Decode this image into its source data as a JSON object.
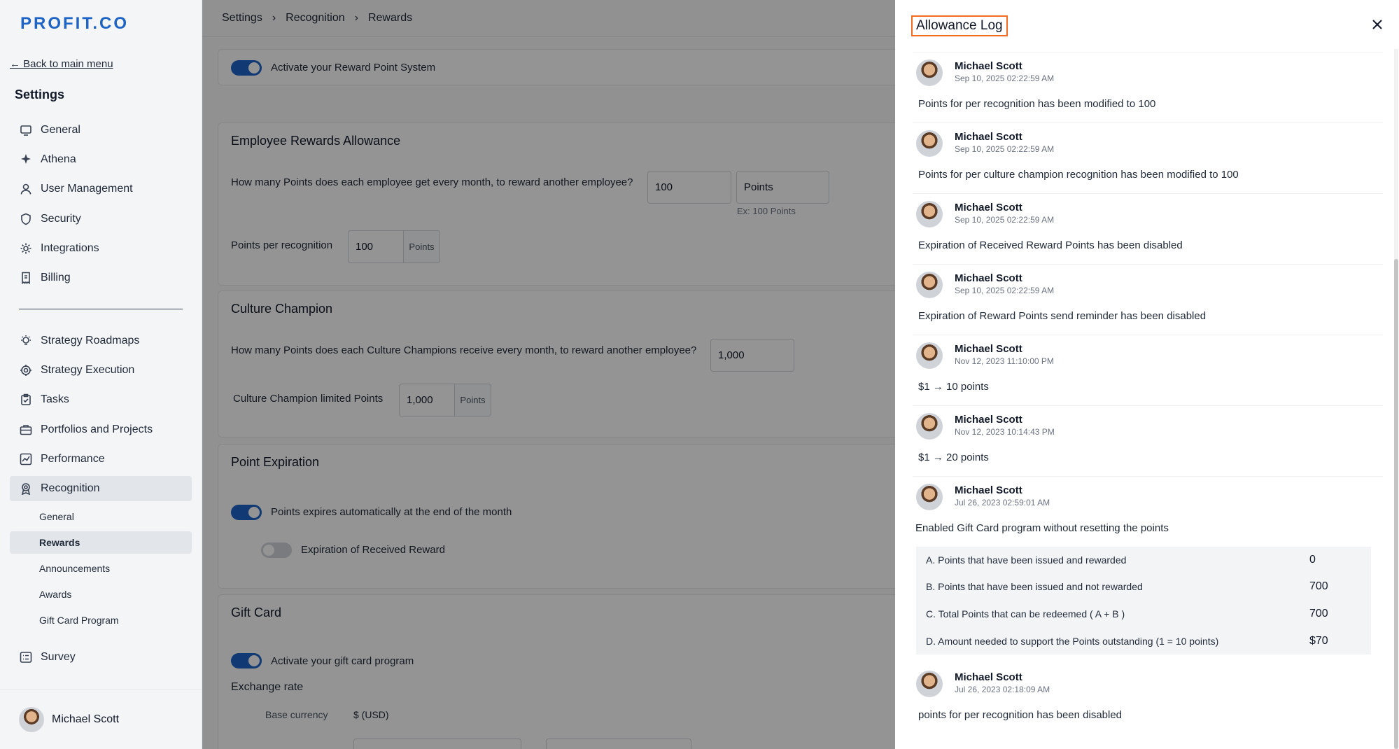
{
  "sidebar": {
    "logo": "PROFIT.CO",
    "back_link": "← Back to main menu",
    "heading": "Settings",
    "items": [
      {
        "label": "General",
        "icon": "monitor-icon"
      },
      {
        "label": "Athena",
        "icon": "sparkle-icon"
      },
      {
        "label": "User Management",
        "icon": "user-icon"
      },
      {
        "label": "Security",
        "icon": "shield-icon"
      },
      {
        "label": "Integrations",
        "icon": "gear-icon"
      },
      {
        "label": "Billing",
        "icon": "receipt-icon"
      }
    ],
    "items2": [
      {
        "label": "Strategy Roadmaps",
        "icon": "bulb-icon"
      },
      {
        "label": "Strategy Execution",
        "icon": "target-icon"
      },
      {
        "label": "Tasks",
        "icon": "clipboard-icon"
      },
      {
        "label": "Portfolios and Projects",
        "icon": "briefcase-icon"
      },
      {
        "label": "Performance",
        "icon": "chart-icon"
      },
      {
        "label": "Recognition",
        "icon": "award-icon"
      }
    ],
    "recognition_sub": [
      "General",
      "Rewards",
      "Announcements",
      "Awards",
      "Gift Card Program"
    ],
    "survey": {
      "label": "Survey",
      "icon": "survey-icon"
    },
    "user_name": "Michael Scott"
  },
  "breadcrumb": [
    "Settings",
    "›",
    "Recognition",
    "›",
    "Rewards"
  ],
  "main": {
    "activate_label": "Activate your Reward Point System",
    "allowance": {
      "title": "Employee Rewards Allowance",
      "question": "How many Points does each employee get every month, to reward another employee?",
      "value": "100",
      "unit": "Points",
      "hint": "Ex: 100 Points",
      "per_recognition_label": "Points per recognition",
      "per_recognition_value": "100",
      "per_recognition_unit": "Points"
    },
    "champion": {
      "title": "Culture Champion",
      "question": "How many Points does each Culture Champions receive every month, to reward another employee?",
      "value": "1,000",
      "limited_label": "Culture Champion limited Points",
      "limited_value": "1,000",
      "limited_unit": "Points"
    },
    "expiration": {
      "title": "Point Expiration",
      "auto_label": "Points expires automatically at the end of the month",
      "received_label": "Expiration of Received Reward"
    },
    "gift": {
      "title": "Gift Card",
      "activate_label": "Activate your gift card program",
      "exchange_label": "Exchange rate",
      "base_currency_label": "Base currency",
      "base_currency_value": "$ (USD)"
    }
  },
  "drawer": {
    "title": "Allowance Log",
    "entries": [
      {
        "name": "Michael Scott",
        "time": "Sep 10, 2025 02:22:59 AM",
        "msg": "Points for per recognition has been modified to 100"
      },
      {
        "name": "Michael Scott",
        "time": "Sep 10, 2025 02:22:59 AM",
        "msg": "Points for per culture champion recognition has been modified to 100"
      },
      {
        "name": "Michael Scott",
        "time": "Sep 10, 2025 02:22:59 AM",
        "msg": "Expiration of Received Reward Points has been disabled"
      },
      {
        "name": "Michael Scott",
        "time": "Sep 10, 2025 02:22:59 AM",
        "msg": "Expiration of Reward Points send reminder has been disabled"
      },
      {
        "name": "Michael Scott",
        "time": "Nov 12, 2023 11:10:00 PM",
        "msg": "$1 → 10 points"
      },
      {
        "name": "Michael Scott",
        "time": "Nov 12, 2023 10:14:43 PM",
        "msg": "$1 → 20 points"
      },
      {
        "name": "Michael Scott",
        "time": "Jul 26, 2023 02:59:01 AM",
        "msg": "Enabled Gift Card program without resetting the points"
      },
      {
        "name": "Michael Scott",
        "time": "Jul 26, 2023 02:18:09 AM",
        "msg": "points for per recognition has been disabled"
      }
    ],
    "summary": [
      {
        "label": "A. Points that have been issued and rewarded",
        "value": "0"
      },
      {
        "label": "B. Points that have been issued and not rewarded",
        "value": "700"
      },
      {
        "label": "C. Total Points that can be redeemed ( A + B )",
        "value": "700"
      },
      {
        "label": "D. Amount needed to support the Points outstanding (1 = 10 points)",
        "value": "$70"
      }
    ]
  },
  "colors": {
    "accent": "#1e63c6",
    "highlight": "#f26b21"
  }
}
